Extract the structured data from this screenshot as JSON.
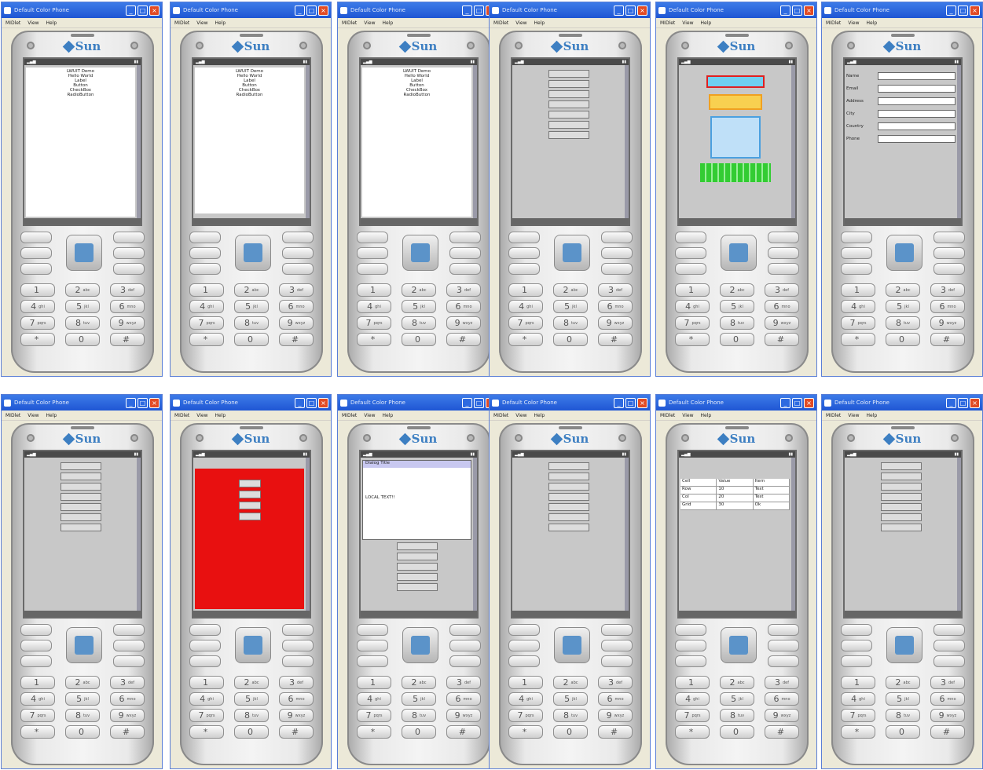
{
  "app": {
    "window_title": "Default Color Phone",
    "menu": [
      "MIDlet",
      "View",
      "Help"
    ],
    "brand": "Sun"
  },
  "keypad": {
    "rows": [
      [
        {
          "digit": "1",
          "letters": ""
        },
        {
          "digit": "2",
          "letters": "abc"
        },
        {
          "digit": "3",
          "letters": "def"
        }
      ],
      [
        {
          "digit": "4",
          "letters": "ghi"
        },
        {
          "digit": "5",
          "letters": "jkl"
        },
        {
          "digit": "6",
          "letters": "mno"
        }
      ],
      [
        {
          "digit": "7",
          "letters": "pqrs"
        },
        {
          "digit": "8",
          "letters": "tuv"
        },
        {
          "digit": "9",
          "letters": "wxyz"
        }
      ],
      [
        {
          "digit": "*",
          "letters": ""
        },
        {
          "digit": "0",
          "letters": ""
        },
        {
          "digit": "#",
          "letters": ""
        }
      ]
    ]
  },
  "screens": {
    "s1": {
      "title": "LWUIT Demo",
      "text": [
        "Hello World",
        "Label",
        "Button",
        "CheckBox",
        "RadioButton"
      ]
    },
    "s6": {
      "labels": [
        "Name",
        "Email",
        "Address",
        "City",
        "Country",
        "Phone"
      ]
    },
    "s9": {
      "dialog_title": "Dialog Title",
      "dialog_text": "LOCAL TEXT!!"
    },
    "s11": {
      "rows": [
        {
          "c1": "Cell",
          "c2": "Value",
          "c3": "Item"
        },
        {
          "c1": "Row",
          "c2": "10",
          "c3": "Text"
        },
        {
          "c1": "Col",
          "c2": "20",
          "c3": "Test"
        },
        {
          "c1": "Grid",
          "c2": "30",
          "c3": "Ok"
        }
      ]
    }
  },
  "colors": {
    "title_bar": "#1f56d4",
    "phone_silver": "#e9e9e9",
    "screen_gray": "#c8c8c8",
    "red_screen": "#e81010",
    "sun_blue": "#3d7fc2"
  }
}
